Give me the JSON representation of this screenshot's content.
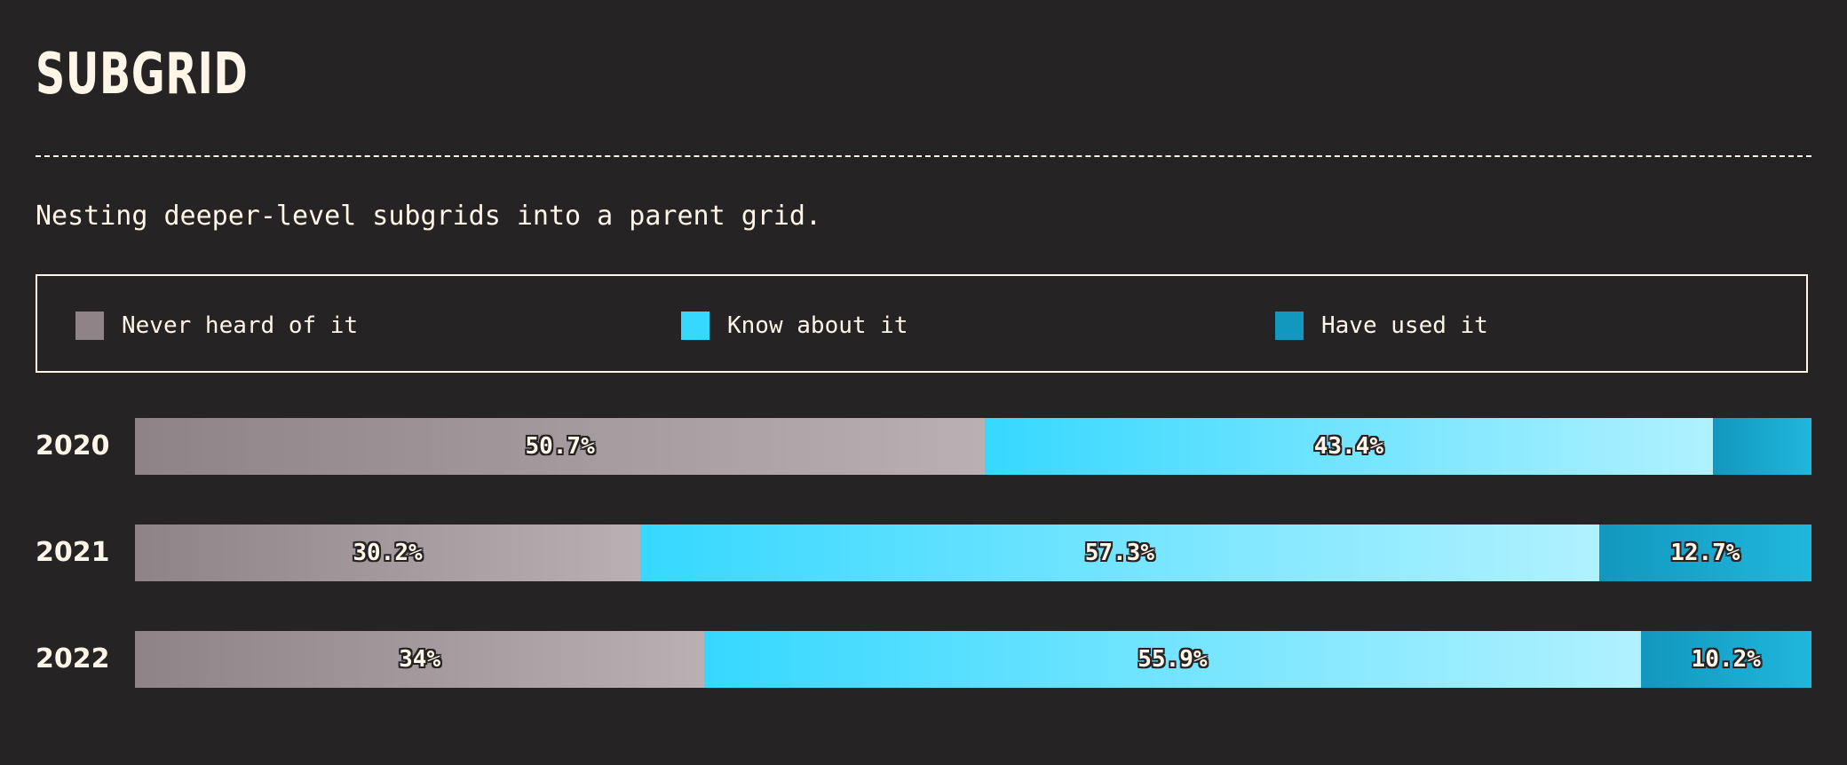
{
  "title": "SUBGRID",
  "subtitle": "Nesting deeper-level subgrids into a parent grid.",
  "legend": [
    {
      "label": "Never heard of it",
      "color": "#8e8387"
    },
    {
      "label": "Know about it",
      "color": "#36d8ff"
    },
    {
      "label": "Have used it",
      "color": "#1297be"
    }
  ],
  "chart_data": {
    "type": "bar",
    "orientation": "horizontal",
    "stacked": true,
    "categories": [
      "2020",
      "2021",
      "2022"
    ],
    "series": [
      {
        "name": "Never heard of it",
        "values": [
          50.7,
          30.2,
          34
        ],
        "labels": [
          "50.7%",
          "30.2%",
          "34%"
        ],
        "color": "#8e8387"
      },
      {
        "name": "Know about it",
        "values": [
          43.4,
          57.3,
          55.9
        ],
        "labels": [
          "43.4%",
          "57.3%",
          "55.9%"
        ],
        "color": "#36d8ff"
      },
      {
        "name": "Have used it",
        "values": [
          5.9,
          12.7,
          10.2
        ],
        "labels": [
          "",
          "12.7%",
          "10.2%"
        ],
        "color": "#1297be"
      }
    ],
    "xlim": [
      0,
      100
    ],
    "unit": "%",
    "legend_position": "top"
  }
}
